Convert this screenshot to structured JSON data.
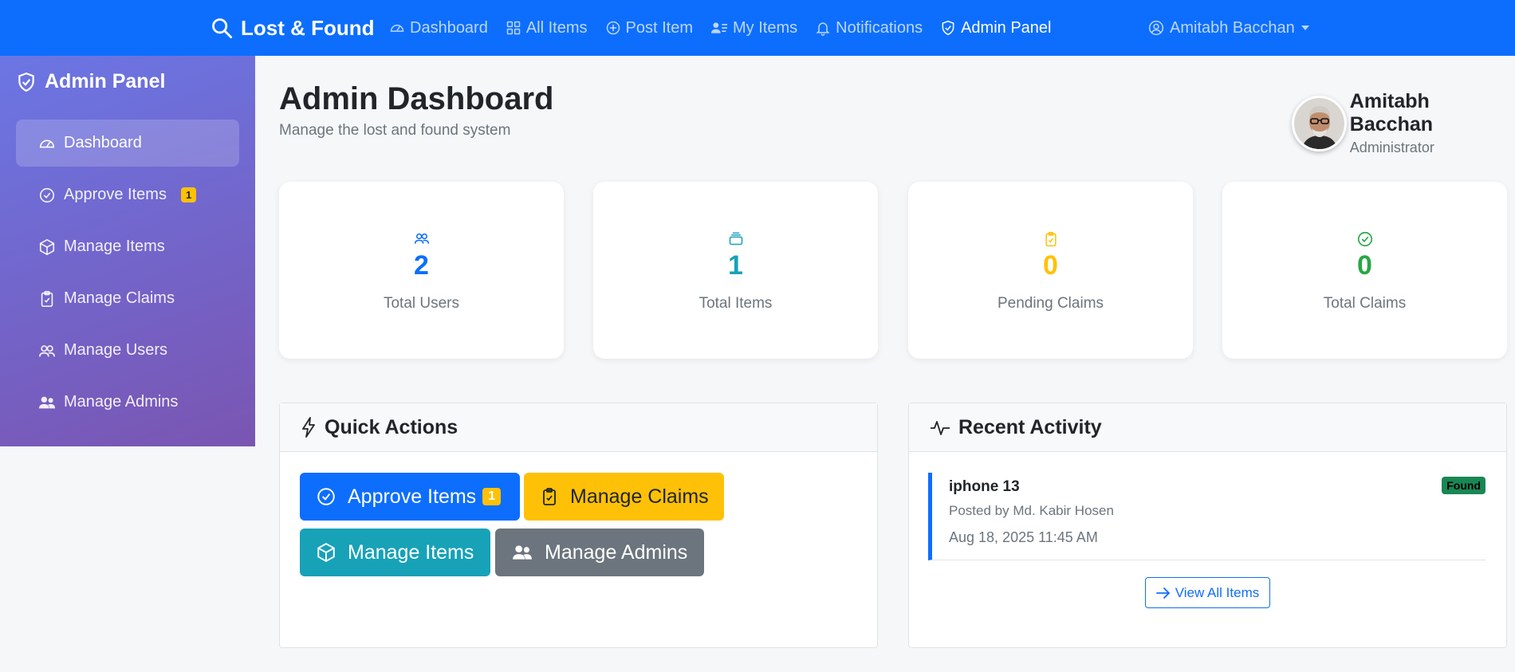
{
  "navbar": {
    "brand": "Lost & Found",
    "links": [
      {
        "label": "Dashboard",
        "icon": "speedometer-icon"
      },
      {
        "label": "All Items",
        "icon": "grid-icon"
      },
      {
        "label": "Post Item",
        "icon": "plus-circle-icon"
      },
      {
        "label": "My Items",
        "icon": "person-lines-icon"
      },
      {
        "label": "Notifications",
        "icon": "bell-icon"
      },
      {
        "label": "Admin Panel",
        "icon": "shield-check-icon",
        "active": true
      }
    ],
    "user": "Amitabh Bacchan"
  },
  "sidebar": {
    "title": "Admin Panel",
    "items": [
      {
        "label": "Dashboard",
        "icon": "speedometer-icon",
        "active": true
      },
      {
        "label": "Approve Items",
        "icon": "check-circle-icon",
        "badge": "1"
      },
      {
        "label": "Manage Items",
        "icon": "box-icon"
      },
      {
        "label": "Manage Claims",
        "icon": "clipboard-check-icon"
      },
      {
        "label": "Manage Users",
        "icon": "people-icon"
      },
      {
        "label": "Manage Admins",
        "icon": "people-fill-icon"
      }
    ]
  },
  "header": {
    "title": "Admin Dashboard",
    "subtitle": "Manage the lost and found system"
  },
  "profile": {
    "name": "Amitabh Bacchan",
    "role": "Administrator"
  },
  "stats": [
    {
      "value": "2",
      "label": "Total Users",
      "icon": "people-icon",
      "color": "#0d6efd"
    },
    {
      "value": "1",
      "label": "Total Items",
      "icon": "collection-icon",
      "color": "#17a2b8"
    },
    {
      "value": "0",
      "label": "Pending Claims",
      "icon": "clipboard-check-icon",
      "color": "#ffc107"
    },
    {
      "value": "0",
      "label": "Total Claims",
      "icon": "check-circle-icon",
      "color": "#28a745"
    }
  ],
  "quick_actions": {
    "title": "Quick Actions",
    "buttons": [
      {
        "label": "Approve Items",
        "badge": "1",
        "icon": "check-circle-icon",
        "color": "#0d6efd"
      },
      {
        "label": "Manage Claims",
        "icon": "clipboard-check-icon",
        "color": "#ffc107"
      },
      {
        "label": "Manage Items",
        "icon": "box-icon",
        "color": "#17a2b8"
      },
      {
        "label": "Manage Admins",
        "icon": "people-fill-icon",
        "color": "#6c757d"
      }
    ]
  },
  "recent_activity": {
    "title": "Recent Activity",
    "items": [
      {
        "title": "iphone 13",
        "posted_by": "Posted by Md. Kabir Hosen",
        "date": "Aug 18, 2025 11:45 AM",
        "status": "Found"
      }
    ],
    "view_all": "View All Items"
  }
}
